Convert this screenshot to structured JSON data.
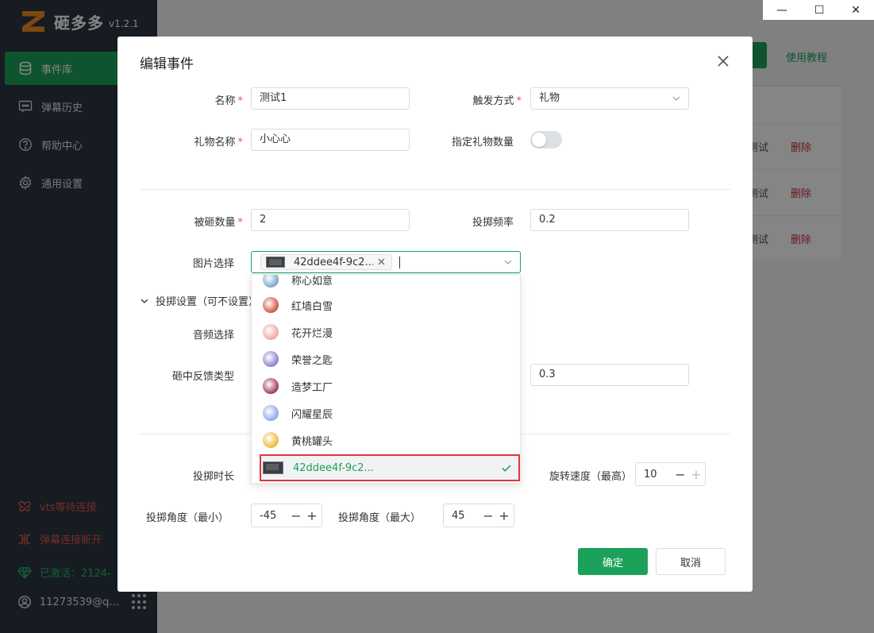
{
  "app": {
    "name": "砸多多",
    "version": "v1.2.1"
  },
  "sidebar": {
    "items": [
      {
        "label": "事件库",
        "icon": "database-icon",
        "active": true
      },
      {
        "label": "弹幕历史",
        "icon": "chat-icon",
        "active": false
      },
      {
        "label": "帮助中心",
        "icon": "help-icon",
        "active": false
      },
      {
        "label": "通用设置",
        "icon": "gear-icon",
        "active": false
      }
    ],
    "status": {
      "vts": "vts等待连接",
      "danmaku": "弹幕连接断开",
      "activated": "已激活：2124-",
      "user": "11273539@q..."
    }
  },
  "background": {
    "tutorial_link": "使用教程",
    "rows": [
      {
        "test": "测试",
        "delete": "删除"
      },
      {
        "test": "测试",
        "delete": "删除"
      },
      {
        "test": "测试",
        "delete": "删除"
      }
    ]
  },
  "dialog": {
    "title": "编辑事件",
    "fields": {
      "name": {
        "label": "名称",
        "value": "测试1"
      },
      "trigger": {
        "label": "触发方式",
        "value": "礼物"
      },
      "gift_name": {
        "label": "礼物名称",
        "value": "小心心"
      },
      "gift_count": {
        "label": "指定礼物数量",
        "enabled": false
      },
      "hit_count": {
        "label": "被砸数量",
        "value": "2"
      },
      "throw_freq": {
        "label": "投掷频率",
        "value": "0.2"
      },
      "image": {
        "label": "图片选择",
        "selected_tag": "42ddee4f-9c2..."
      },
      "throw_settings": "投掷设置（可不设置）",
      "audio": {
        "label": "音频选择"
      },
      "feedback": {
        "label": "砸中反馈类型",
        "value": "0.3"
      },
      "throw_duration": {
        "label": "投掷时长"
      },
      "rotate_speed_max": {
        "label": "旋转速度（最高）",
        "value": "10"
      },
      "angle_min": {
        "label": "投掷角度（最小）",
        "value": "-45"
      },
      "angle_max": {
        "label": "投掷角度（最大）",
        "value": "45"
      }
    },
    "buttons": {
      "ok": "确定",
      "cancel": "取消"
    }
  },
  "dropdown": {
    "options": [
      {
        "label": "称心如意",
        "color": "#7aa6c9"
      },
      {
        "label": "红墙白雪",
        "color": "#d0533a"
      },
      {
        "label": "花开烂漫",
        "color": "#f2a7a0"
      },
      {
        "label": "荣誉之匙",
        "color": "#8b7fd6"
      },
      {
        "label": "造梦工厂",
        "color": "#9c3a5c"
      },
      {
        "label": "闪耀星辰",
        "color": "#8fa6e8"
      },
      {
        "label": "黄桃罐头",
        "color": "#f0b93a"
      },
      {
        "label": "42ddee4f-9c2...",
        "selected": true
      }
    ]
  },
  "colors": {
    "accent": "#1ba15a",
    "danger": "#e0574f",
    "sidebar": "#2b3642"
  }
}
